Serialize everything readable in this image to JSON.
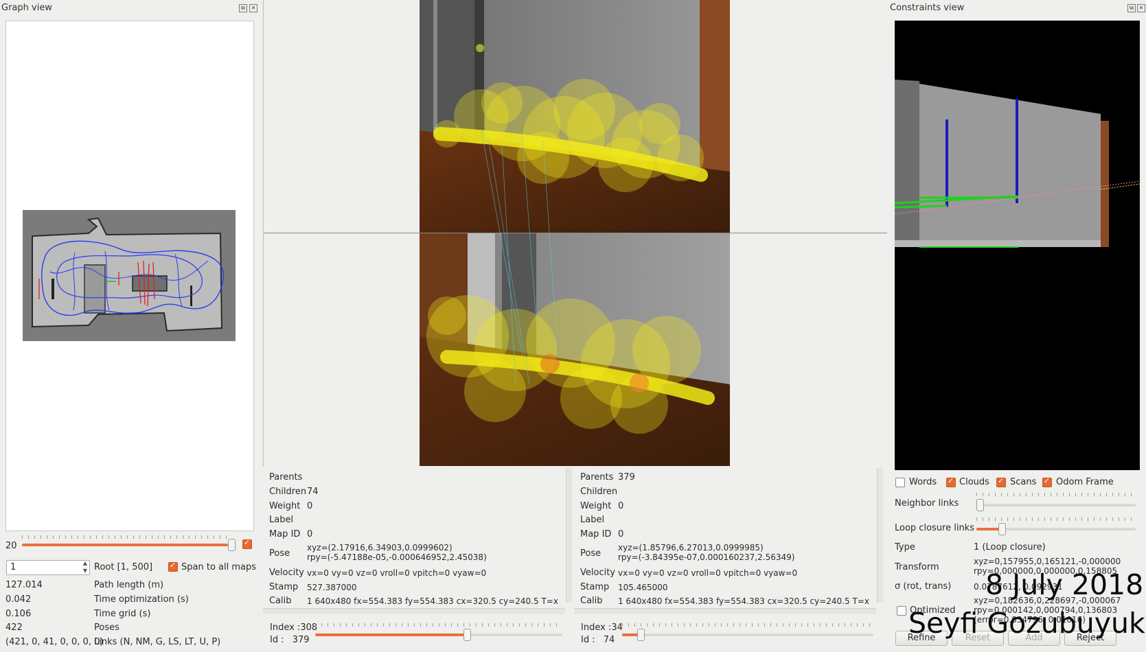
{
  "graph_view": {
    "title": "Graph view",
    "slider_value": "20",
    "spin_value": "1",
    "root_label": "Root [1, 500]",
    "span_label": "Span to all maps",
    "stats": [
      {
        "value": "127.014",
        "label": "Path length (m)"
      },
      {
        "value": "0.042",
        "label": "Time optimization (s)"
      },
      {
        "value": "0.106",
        "label": "Time grid (s)"
      },
      {
        "value": "422",
        "label": "Poses"
      },
      {
        "value": "(421, 0, 41, 0, 0, 0, 0)",
        "label": "Links (N, NM, G, LS, LT, U, P)"
      }
    ]
  },
  "left_info": {
    "rows": [
      {
        "key": "Parents",
        "value": ""
      },
      {
        "key": "Children",
        "value": "74"
      },
      {
        "key": "Weight",
        "value": "0"
      },
      {
        "key": "Label",
        "value": ""
      },
      {
        "key": "Map ID",
        "value": "0"
      }
    ],
    "pose_key": "Pose",
    "pose_xyz": "xyz=(2.17916,6.34903,0.0999602)",
    "pose_rpy": "rpy=(-5.47188e-05,-0.000646952,2.45038)",
    "velocity_key": "Velocity",
    "velocity": "vx=0 vy=0 vz=0 vroll=0 vpitch=0 vyaw=0",
    "stamp_key": "Stamp",
    "stamp": "527.387000",
    "calib_key": "Calib",
    "calib": "1 640x480 fx=554.383 fy=554.383 cx=320.5 cy=240.5 T=xyz=0",
    "index_label": "Index :",
    "index": "308",
    "id_label": "Id :",
    "id": "379",
    "slider_fraction": 0.61
  },
  "right_info": {
    "rows": [
      {
        "key": "Parents",
        "value": "379"
      },
      {
        "key": "Children",
        "value": ""
      },
      {
        "key": "Weight",
        "value": "0"
      },
      {
        "key": "Label",
        "value": ""
      },
      {
        "key": "Map ID",
        "value": "0"
      }
    ],
    "pose_key": "Pose",
    "pose_xyz": "xyz=(1.85796,6.27013,0.0999985)",
    "pose_rpy": "rpy=(-3.84395e-07,0.000160237,2.56349)",
    "velocity_key": "Velocity",
    "velocity": "vx=0 vy=0 vz=0 vroll=0 vpitch=0 vyaw=0",
    "stamp_key": "Stamp",
    "stamp": "105.465000",
    "calib_key": "Calib",
    "calib": "1 640x480 fx=554.383 fy=554.383 cx=320.5 cy=240.5 T=xyz=0",
    "index_label": "Index :",
    "index": "34",
    "id_label": "Id :",
    "id": "74",
    "slider_fraction": 0.07
  },
  "constraints_view": {
    "title": "Constraints view",
    "checkboxes": [
      {
        "label": "Words",
        "checked": false
      },
      {
        "label": "Clouds",
        "checked": true
      },
      {
        "label": "Scans",
        "checked": true
      },
      {
        "label": "Odom Frame",
        "checked": true
      }
    ],
    "neighbor_links_label": "Neighbor links",
    "loop_closure_links_label": "Loop closure links",
    "type_label": "Type",
    "type_value": "1 (Loop closure)",
    "transform_label": "Transform",
    "transform_xyz": "xyz=0,157955,0,165121,-0,000000",
    "transform_rpy": "rpy=0,000000,0,000000,0,158805",
    "sigma_label": "σ (rot, trans)",
    "sigma_value": "0.0787612, 0.092931",
    "optimized_label": "Optimized",
    "optimized_xyz": "xyz=0,182636,0,228697,-0,000067",
    "optimized_rpy": "rpy=0,000142,0,000794,0,136803",
    "optimized_error": "(error=0.034796, 0.01016)",
    "buttons": {
      "refine": "Refine",
      "reset": "Reset",
      "add": "Add",
      "reject": "Reject"
    }
  },
  "watermark": {
    "date": "8 July 2018",
    "author": "Seyfi Gozubuyuk"
  },
  "colors": {
    "accent": "#e9703c",
    "loop_closure": "#e02020",
    "path": "#2a3cf0",
    "blob": "#f2ea18"
  }
}
